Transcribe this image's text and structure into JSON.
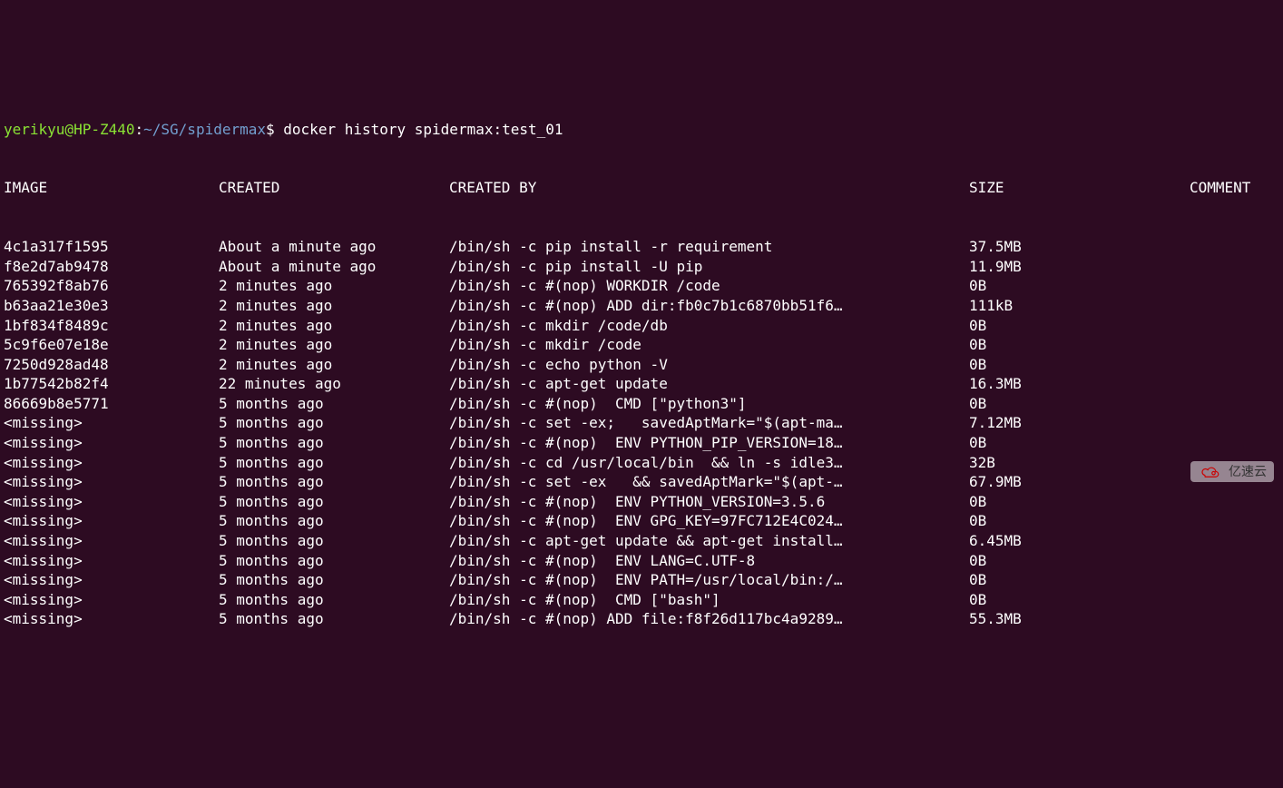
{
  "prompt": {
    "user_host": "yerikyu@HP-Z440",
    "separator": ":",
    "path": "~/SG/spidermax",
    "dollar": "$",
    "command": "docker history spidermax:test_01"
  },
  "headers": {
    "image": "IMAGE",
    "created": "CREATED",
    "created_by": "CREATED BY",
    "size": "SIZE",
    "comment": "COMMENT"
  },
  "rows": [
    {
      "image": "4c1a317f1595",
      "created": "About a minute ago",
      "created_by": "/bin/sh -c pip install -r requirement",
      "size": "37.5MB"
    },
    {
      "image": "f8e2d7ab9478",
      "created": "About a minute ago",
      "created_by": "/bin/sh -c pip install -U pip",
      "size": "11.9MB"
    },
    {
      "image": "765392f8ab76",
      "created": "2 minutes ago",
      "created_by": "/bin/sh -c #(nop) WORKDIR /code",
      "size": "0B"
    },
    {
      "image": "b63aa21e30e3",
      "created": "2 minutes ago",
      "created_by": "/bin/sh -c #(nop) ADD dir:fb0c7b1c6870bb51f6…",
      "size": "111kB"
    },
    {
      "image": "1bf834f8489c",
      "created": "2 minutes ago",
      "created_by": "/bin/sh -c mkdir /code/db",
      "size": "0B"
    },
    {
      "image": "5c9f6e07e18e",
      "created": "2 minutes ago",
      "created_by": "/bin/sh -c mkdir /code",
      "size": "0B"
    },
    {
      "image": "7250d928ad48",
      "created": "2 minutes ago",
      "created_by": "/bin/sh -c echo python -V",
      "size": "0B"
    },
    {
      "image": "1b77542b82f4",
      "created": "22 minutes ago",
      "created_by": "/bin/sh -c apt-get update",
      "size": "16.3MB"
    },
    {
      "image": "86669b8e5771",
      "created": "5 months ago",
      "created_by": "/bin/sh -c #(nop)  CMD [\"python3\"]",
      "size": "0B"
    },
    {
      "image": "<missing>",
      "created": "5 months ago",
      "created_by": "/bin/sh -c set -ex;   savedAptMark=\"$(apt-ma…",
      "size": "7.12MB"
    },
    {
      "image": "<missing>",
      "created": "5 months ago",
      "created_by": "/bin/sh -c #(nop)  ENV PYTHON_PIP_VERSION=18…",
      "size": "0B"
    },
    {
      "image": "<missing>",
      "created": "5 months ago",
      "created_by": "/bin/sh -c cd /usr/local/bin  && ln -s idle3…",
      "size": "32B"
    },
    {
      "image": "<missing>",
      "created": "5 months ago",
      "created_by": "/bin/sh -c set -ex   && savedAptMark=\"$(apt-…",
      "size": "67.9MB"
    },
    {
      "image": "<missing>",
      "created": "5 months ago",
      "created_by": "/bin/sh -c #(nop)  ENV PYTHON_VERSION=3.5.6",
      "size": "0B"
    },
    {
      "image": "<missing>",
      "created": "5 months ago",
      "created_by": "/bin/sh -c #(nop)  ENV GPG_KEY=97FC712E4C024…",
      "size": "0B"
    },
    {
      "image": "<missing>",
      "created": "5 months ago",
      "created_by": "/bin/sh -c apt-get update && apt-get install…",
      "size": "6.45MB"
    },
    {
      "image": "<missing>",
      "created": "5 months ago",
      "created_by": "/bin/sh -c #(nop)  ENV LANG=C.UTF-8",
      "size": "0B"
    },
    {
      "image": "<missing>",
      "created": "5 months ago",
      "created_by": "/bin/sh -c #(nop)  ENV PATH=/usr/local/bin:/…",
      "size": "0B"
    },
    {
      "image": "<missing>",
      "created": "5 months ago",
      "created_by": "/bin/sh -c #(nop)  CMD [\"bash\"]",
      "size": "0B"
    },
    {
      "image": "<missing>",
      "created": "5 months ago",
      "created_by": "/bin/sh -c #(nop) ADD file:f8f26d117bc4a9289…",
      "size": "55.3MB"
    }
  ],
  "watermark": {
    "text": "亿速云"
  }
}
